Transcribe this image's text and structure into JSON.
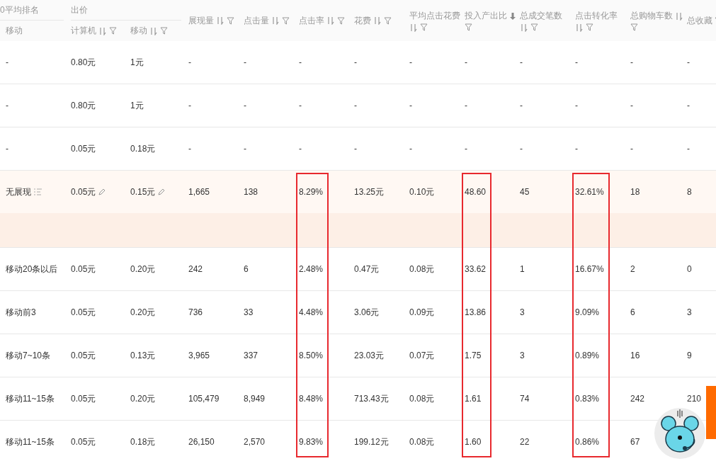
{
  "table": {
    "header_groups": [
      {
        "label": "0平均排名"
      },
      {
        "label": "出价"
      }
    ],
    "columns": [
      {
        "label": "移动",
        "kind": "lead",
        "sortable": false,
        "sorted": false,
        "filter": false,
        "highlighted": false
      },
      {
        "label": "计算机",
        "kind": "lead",
        "sortable": true,
        "sorted": false,
        "filter": true,
        "highlighted": false
      },
      {
        "label": "移动",
        "kind": "member",
        "sortable": true,
        "sorted": false,
        "filter": true,
        "highlighted": false
      },
      {
        "label": "展现量",
        "kind": "single",
        "sortable": true,
        "sorted": false,
        "filter": true,
        "highlighted": false
      },
      {
        "label": "点击量",
        "kind": "single",
        "sortable": true,
        "sorted": false,
        "filter": true,
        "highlighted": false
      },
      {
        "label": "点击率",
        "kind": "single",
        "sortable": true,
        "sorted": false,
        "filter": true,
        "highlighted": true
      },
      {
        "label": "花费",
        "kind": "single",
        "sortable": true,
        "sorted": false,
        "filter": true,
        "highlighted": false
      },
      {
        "label": "平均点击花费",
        "kind": "single",
        "sortable": true,
        "sorted": false,
        "filter": true,
        "highlighted": false
      },
      {
        "label": "投入产出比",
        "kind": "single",
        "sortable": true,
        "sorted": true,
        "filter": true,
        "highlighted": true
      },
      {
        "label": "总成交笔数",
        "kind": "single",
        "sortable": true,
        "sorted": false,
        "filter": true,
        "highlighted": false
      },
      {
        "label": "点击转化率",
        "kind": "single",
        "sortable": true,
        "sorted": false,
        "filter": true,
        "highlighted": true
      },
      {
        "label": "总购物车数",
        "kind": "single",
        "sortable": true,
        "sorted": false,
        "filter": true,
        "highlighted": false
      },
      {
        "label": "总收藏",
        "kind": "single",
        "sortable": false,
        "sorted": false,
        "filter": true,
        "highlighted": false
      }
    ],
    "rows": [
      {
        "expanded": false,
        "editable": false,
        "cells": [
          "-",
          "0.80元",
          "1元",
          "-",
          "-",
          "-",
          "-",
          "-",
          "-",
          "-",
          "-",
          "-",
          "-"
        ]
      },
      {
        "expanded": false,
        "editable": false,
        "cells": [
          "-",
          "0.80元",
          "1元",
          "-",
          "-",
          "-",
          "-",
          "-",
          "-",
          "-",
          "-",
          "-",
          "-"
        ]
      },
      {
        "expanded": false,
        "editable": false,
        "cells": [
          "-",
          "0.05元",
          "0.18元",
          "-",
          "-",
          "-",
          "-",
          "-",
          "-",
          "-",
          "-",
          "-",
          "-"
        ]
      },
      {
        "expanded": true,
        "editable": true,
        "cells": [
          "无展现",
          "0.05元",
          "0.15元",
          "1,665",
          "138",
          "8.29%",
          "13.25元",
          "0.10元",
          "48.60",
          "45",
          "32.61%",
          "18",
          "8"
        ]
      },
      {
        "expanded": false,
        "editable": false,
        "cells": [
          "移动20条以后",
          "0.05元",
          "0.20元",
          "242",
          "6",
          "2.48%",
          "0.47元",
          "0.08元",
          "33.62",
          "1",
          "16.67%",
          "2",
          "0"
        ]
      },
      {
        "expanded": false,
        "editable": false,
        "cells": [
          "移动前3",
          "0.05元",
          "0.20元",
          "736",
          "33",
          "4.48%",
          "3.06元",
          "0.09元",
          "13.86",
          "3",
          "9.09%",
          "6",
          "3"
        ]
      },
      {
        "expanded": false,
        "editable": false,
        "cells": [
          "移动7~10条",
          "0.05元",
          "0.13元",
          "3,965",
          "337",
          "8.50%",
          "23.03元",
          "0.07元",
          "1.75",
          "3",
          "0.89%",
          "16",
          "9"
        ]
      },
      {
        "expanded": false,
        "editable": false,
        "cells": [
          "移动11~15条",
          "0.05元",
          "0.20元",
          "105,479",
          "8,949",
          "8.48%",
          "713.43元",
          "0.08元",
          "1.61",
          "74",
          "0.83%",
          "242",
          "210"
        ]
      },
      {
        "expanded": false,
        "editable": false,
        "cells": [
          "移动11~15条",
          "0.05元",
          "0.18元",
          "26,150",
          "2,570",
          "9.83%",
          "199.12元",
          "0.08元",
          "1.60",
          "22",
          "0.86%",
          "67"
        ]
      }
    ]
  }
}
